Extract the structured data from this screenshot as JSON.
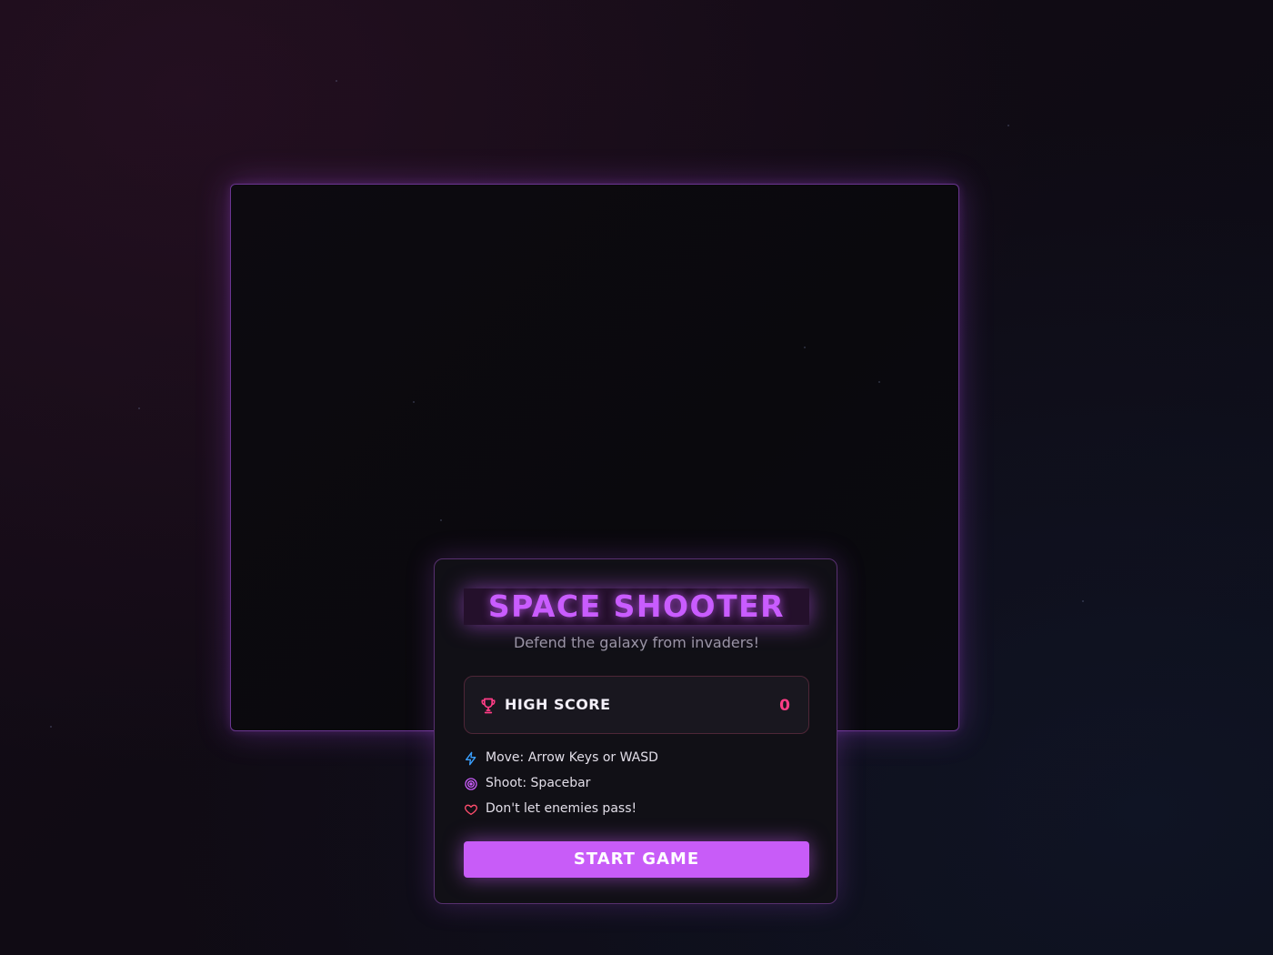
{
  "colors": {
    "accent": "#c85cf8",
    "title": "#c95cff",
    "score": "#ff3d86",
    "canvas_border": "#6a3590"
  },
  "menu": {
    "title": "SPACE SHOOTER",
    "subtitle": "Defend the galaxy from invaders!",
    "high_score": {
      "label": "HIGH SCORE",
      "value": "0",
      "icon": "trophy-icon"
    },
    "instructions": [
      {
        "icon": "lightning-icon",
        "text": "Move: Arrow Keys or WASD"
      },
      {
        "icon": "target-icon",
        "text": "Shoot: Spacebar"
      },
      {
        "icon": "heart-icon",
        "text": "Don't let enemies pass!"
      }
    ],
    "start_button": "START GAME"
  }
}
